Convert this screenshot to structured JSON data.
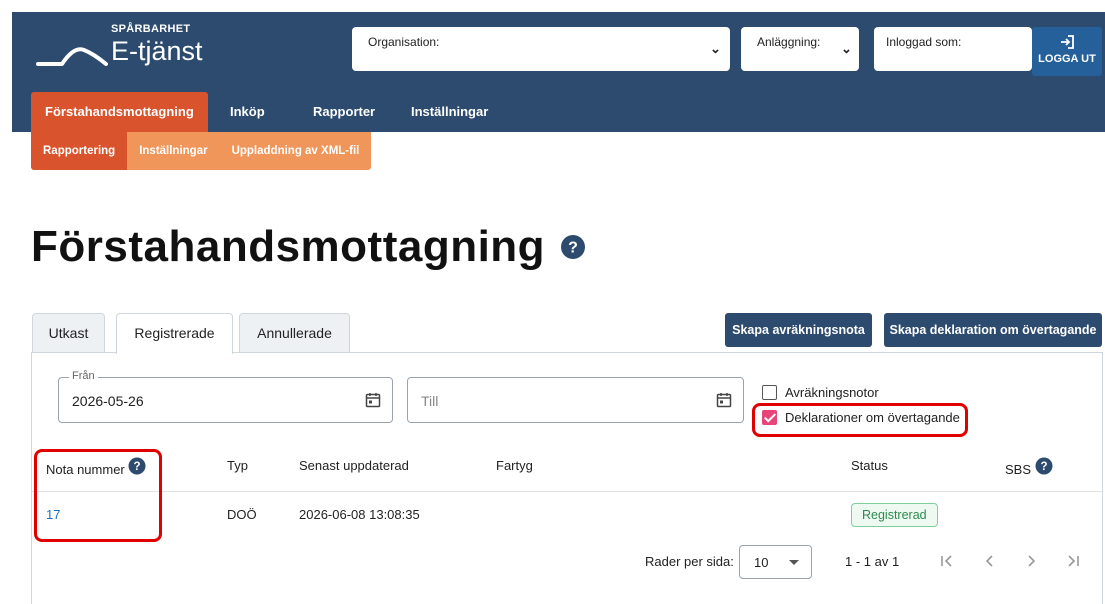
{
  "brand": {
    "superscript": "SPÅRBARHET",
    "name": "E-tjänst"
  },
  "header": {
    "organisation_label": "Organisation:",
    "anlaggning_label": "Anläggning:",
    "inloggad_label": "Inloggad som:",
    "logout_label": "LOGGA UT"
  },
  "nav": {
    "tabs": [
      {
        "label": "Förstahandsmottagning"
      },
      {
        "label": "Inköp"
      },
      {
        "label": "Rapporter"
      },
      {
        "label": "Inställningar"
      }
    ],
    "active_index": 0
  },
  "subnav": {
    "items": [
      {
        "label": "Rapportering"
      },
      {
        "label": "Inställningar"
      },
      {
        "label": "Uppladdning av XML-fil"
      }
    ],
    "active_index": 0
  },
  "page": {
    "title": "Förstahandsmottagning"
  },
  "tabs": [
    {
      "label": "Utkast"
    },
    {
      "label": "Registrerade"
    },
    {
      "label": "Annullerade"
    }
  ],
  "active_tab_index": 1,
  "actions": {
    "create_settlement": "Skapa avräkningsnota",
    "create_declaration": "Skapa deklaration om övertagande"
  },
  "filters": {
    "from_label": "Från",
    "from_value": "2026-05-26",
    "to_placeholder": "Till",
    "checkbox_settlement": {
      "label": "Avräkningsnotor",
      "checked": false
    },
    "checkbox_declaration": {
      "label": "Deklarationer om övertagande",
      "checked": true
    }
  },
  "table": {
    "headers": [
      "Nota nummer",
      "Typ",
      "Senast uppdaterad",
      "Fartyg",
      "Status",
      "SBS"
    ],
    "rows": [
      {
        "nota": "17",
        "typ": "DOÖ",
        "updated": "2026-06-08 13:08:35",
        "fartyg": "",
        "status": "Registrerad"
      }
    ]
  },
  "pagination": {
    "rows_per_page_label": "Rader per sida:",
    "rows_per_page_value": "10",
    "range": "1 - 1 av 1"
  },
  "colors": {
    "header_bg": "#2d4b6e",
    "accent_orange": "#d9532c",
    "subnav_orange": "#f0965a",
    "primary_button": "#2d4b6e",
    "logout_button": "#25609a",
    "checkbox_pink": "#e8447a",
    "highlight_red": "#e00000",
    "status_green": "#2e8a4e"
  }
}
